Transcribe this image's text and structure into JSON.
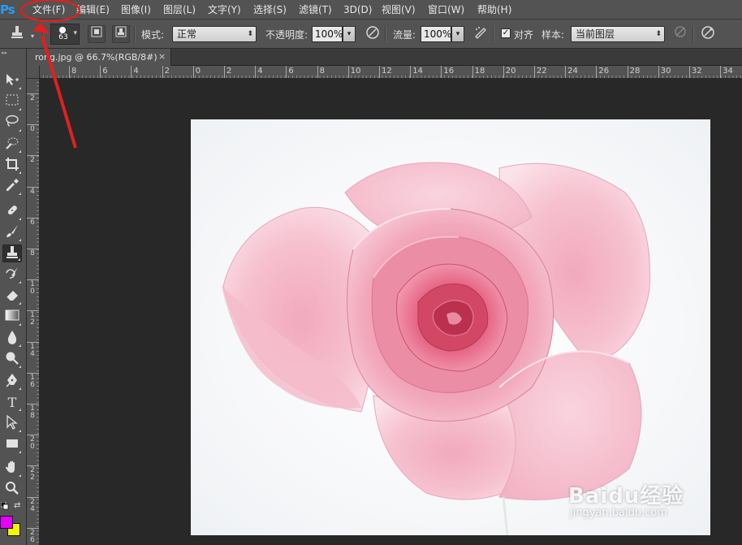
{
  "app": {
    "logo_text": "Ps",
    "menu": [
      "文件(F)",
      "编辑(E)",
      "图像(I)",
      "图层(L)",
      "文字(Y)",
      "选择(S)",
      "滤镜(T)",
      "3D(D)",
      "视图(V)",
      "窗口(W)",
      "帮助(H)"
    ]
  },
  "options": {
    "brush_size": "63",
    "mode_label": "模式:",
    "mode_value": "正常",
    "opacity_label": "不透明度:",
    "opacity_value": "100%",
    "flow_label": "流量:",
    "flow_value": "100%",
    "aligned_label": "对齐",
    "aligned_checked": true,
    "sample_label": "样本:",
    "sample_value": "当前图层"
  },
  "document": {
    "tab_title": "rong.jpg @ 66.7%(RGB/8#)",
    "close_glyph": "×"
  },
  "rulers": {
    "horizontal": [
      "8",
      "6",
      "4",
      "2",
      "0",
      "2",
      "4",
      "6",
      "8",
      "10",
      "12",
      "14",
      "16",
      "18",
      "20",
      "22",
      "24",
      "26",
      "28",
      "30",
      "32",
      "34"
    ],
    "vertical": [
      "2",
      "0",
      "2",
      "4",
      "6",
      "8",
      "10",
      "12",
      "14",
      "16",
      "18",
      "20",
      "22",
      "24",
      "26"
    ]
  },
  "colors": {
    "foreground": "#e400ff",
    "background": "#f5f500",
    "annotation": "#e02020",
    "ps_blue": "#2a9cf2"
  },
  "watermark": {
    "brand": "Baidu经验",
    "url": "jingyan.baidu.com"
  },
  "tools": [
    "move-tool-icon",
    "marquee-tool-icon",
    "lasso-tool-icon",
    "quick-select-tool-icon",
    "crop-tool-icon",
    "eyedropper-tool-icon",
    "healing-brush-tool-icon",
    "brush-tool-icon",
    "clone-stamp-tool-icon",
    "history-brush-tool-icon",
    "eraser-tool-icon",
    "gradient-tool-icon",
    "blur-tool-icon",
    "dodge-tool-icon",
    "pen-tool-icon",
    "type-tool-icon",
    "path-select-tool-icon",
    "rectangle-tool-icon",
    "hand-tool-icon",
    "zoom-tool-icon"
  ]
}
